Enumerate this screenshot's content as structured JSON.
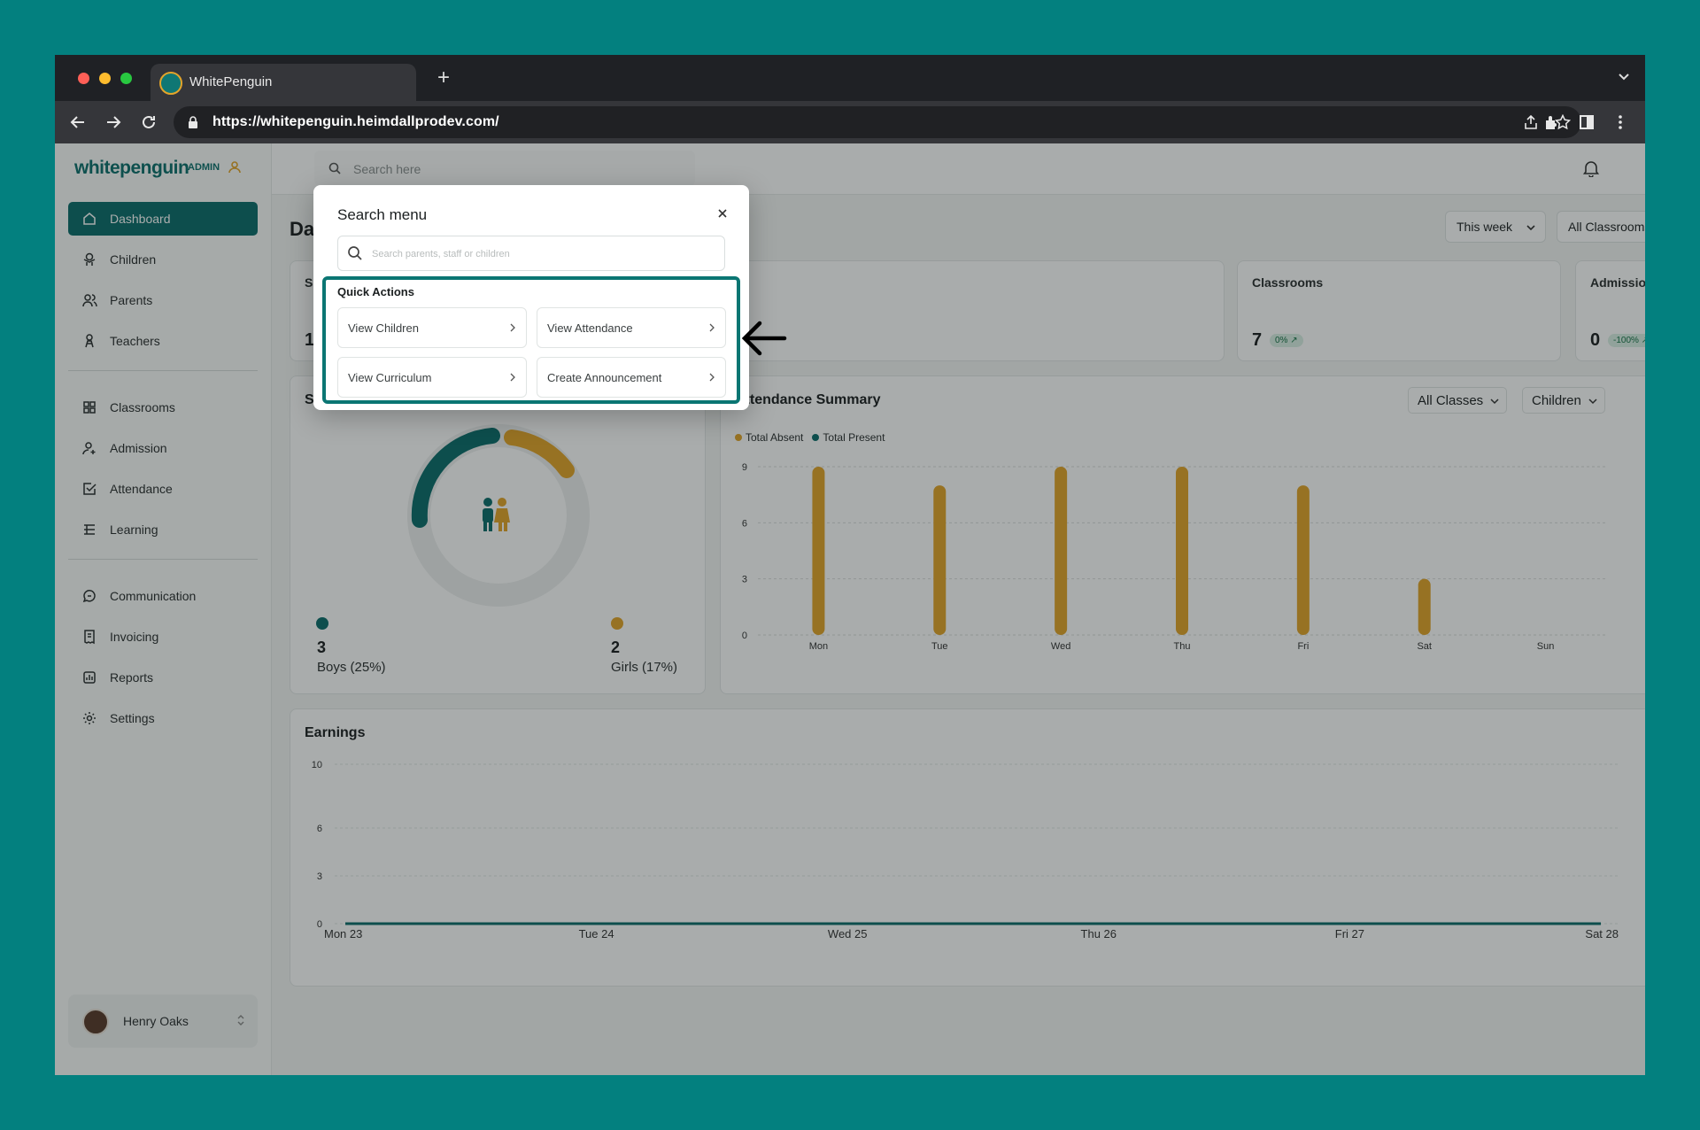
{
  "browser": {
    "tab_title": "WhitePenguin",
    "url": "https://whitepenguin.heimdallprodev.com/"
  },
  "sidebar": {
    "logo": "whitepenguin",
    "badge": "ADMIN",
    "items": [
      {
        "label": "Dashboard",
        "icon": "home-icon",
        "active": true
      },
      {
        "label": "Children",
        "icon": "child-icon"
      },
      {
        "label": "Parents",
        "icon": "parents-icon"
      },
      {
        "label": "Teachers",
        "icon": "teacher-icon"
      },
      {
        "label": "Classrooms",
        "icon": "grid-icon"
      },
      {
        "label": "Admission",
        "icon": "user-add-icon"
      },
      {
        "label": "Attendance",
        "icon": "check-square-icon"
      },
      {
        "label": "Learning",
        "icon": "book-icon"
      },
      {
        "label": "Communication",
        "icon": "chat-icon"
      },
      {
        "label": "Invoicing",
        "icon": "receipt-icon"
      },
      {
        "label": "Reports",
        "icon": "report-icon"
      },
      {
        "label": "Settings",
        "icon": "gear-icon"
      }
    ],
    "user": {
      "name": "Henry Oaks"
    }
  },
  "topbar": {
    "search_placeholder": "Search here"
  },
  "page": {
    "title": "Da",
    "filters": {
      "period": "This week",
      "classrooms": "All Classrooms"
    }
  },
  "stats": [
    {
      "label": "S",
      "value": "1"
    },
    {
      "label": "Classrooms",
      "value": "7",
      "change": "0% ↗"
    },
    {
      "label": "Admissions",
      "value": "0",
      "change": "-100% ↗"
    }
  ],
  "gender": {
    "title": "S",
    "boys": {
      "count": "3",
      "label": "Boys (25%)",
      "color": "#0c6d6b"
    },
    "girls": {
      "count": "2",
      "label": "Girls (17%)",
      "color": "#e3a42a"
    }
  },
  "attendance": {
    "title": "Attendance Summary",
    "filter_class": "All Classes",
    "filter_type": "Children",
    "legend": [
      "Total Absent",
      "Total Present"
    ]
  },
  "earnings": {
    "title": "Earnings"
  },
  "chart_data": [
    {
      "type": "bar",
      "title": "Attendance Summary",
      "categories": [
        "Mon",
        "Tue",
        "Wed",
        "Thu",
        "Fri",
        "Sat",
        "Sun"
      ],
      "series": [
        {
          "name": "Total Absent",
          "color": "#e3a42a",
          "values": [
            9,
            8,
            9,
            9,
            8,
            3,
            0
          ]
        },
        {
          "name": "Total Present",
          "color": "#0c6d6b",
          "values": [
            0,
            0,
            0,
            0,
            0,
            0,
            0
          ]
        }
      ],
      "yticks": [
        0,
        3,
        6,
        9
      ],
      "ylim": [
        0,
        9
      ],
      "grid": true,
      "legend": "top-left"
    },
    {
      "type": "line",
      "title": "Earnings",
      "categories": [
        "Mon 23",
        "Tue 24",
        "Wed 25",
        "Thu 26",
        "Fri 27",
        "Sat 28"
      ],
      "series": [
        {
          "name": "",
          "color": "#0c6d6b",
          "values": [
            0,
            0,
            0,
            0,
            0,
            0
          ]
        }
      ],
      "yticks": [
        0,
        3,
        6,
        10
      ],
      "ylim": [
        0,
        10
      ],
      "grid": true
    }
  ],
  "modal": {
    "title": "Search menu",
    "search_placeholder": "Search parents, staff or children",
    "quick_actions_title": "Quick Actions",
    "actions": [
      {
        "label": "View Children"
      },
      {
        "label": "View Attendance"
      },
      {
        "label": "View Curriculum"
      },
      {
        "label": "Create Announcement"
      }
    ]
  }
}
